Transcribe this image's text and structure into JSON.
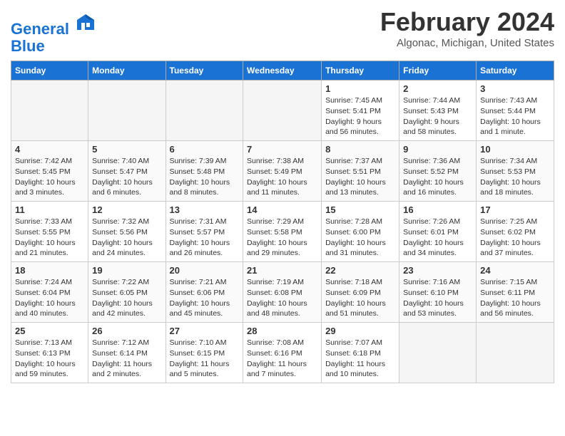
{
  "header": {
    "logo_line1": "General",
    "logo_line2": "Blue",
    "month": "February 2024",
    "location": "Algonac, Michigan, United States"
  },
  "days_of_week": [
    "Sunday",
    "Monday",
    "Tuesday",
    "Wednesday",
    "Thursday",
    "Friday",
    "Saturday"
  ],
  "weeks": [
    [
      {
        "num": "",
        "sunrise": "",
        "sunset": "",
        "daylight": "",
        "empty": true
      },
      {
        "num": "",
        "sunrise": "",
        "sunset": "",
        "daylight": "",
        "empty": true
      },
      {
        "num": "",
        "sunrise": "",
        "sunset": "",
        "daylight": "",
        "empty": true
      },
      {
        "num": "",
        "sunrise": "",
        "sunset": "",
        "daylight": "",
        "empty": true
      },
      {
        "num": "1",
        "sunrise": "Sunrise: 7:45 AM",
        "sunset": "Sunset: 5:41 PM",
        "daylight": "Daylight: 9 hours and 56 minutes."
      },
      {
        "num": "2",
        "sunrise": "Sunrise: 7:44 AM",
        "sunset": "Sunset: 5:43 PM",
        "daylight": "Daylight: 9 hours and 58 minutes."
      },
      {
        "num": "3",
        "sunrise": "Sunrise: 7:43 AM",
        "sunset": "Sunset: 5:44 PM",
        "daylight": "Daylight: 10 hours and 1 minute."
      }
    ],
    [
      {
        "num": "4",
        "sunrise": "Sunrise: 7:42 AM",
        "sunset": "Sunset: 5:45 PM",
        "daylight": "Daylight: 10 hours and 3 minutes."
      },
      {
        "num": "5",
        "sunrise": "Sunrise: 7:40 AM",
        "sunset": "Sunset: 5:47 PM",
        "daylight": "Daylight: 10 hours and 6 minutes."
      },
      {
        "num": "6",
        "sunrise": "Sunrise: 7:39 AM",
        "sunset": "Sunset: 5:48 PM",
        "daylight": "Daylight: 10 hours and 8 minutes."
      },
      {
        "num": "7",
        "sunrise": "Sunrise: 7:38 AM",
        "sunset": "Sunset: 5:49 PM",
        "daylight": "Daylight: 10 hours and 11 minutes."
      },
      {
        "num": "8",
        "sunrise": "Sunrise: 7:37 AM",
        "sunset": "Sunset: 5:51 PM",
        "daylight": "Daylight: 10 hours and 13 minutes."
      },
      {
        "num": "9",
        "sunrise": "Sunrise: 7:36 AM",
        "sunset": "Sunset: 5:52 PM",
        "daylight": "Daylight: 10 hours and 16 minutes."
      },
      {
        "num": "10",
        "sunrise": "Sunrise: 7:34 AM",
        "sunset": "Sunset: 5:53 PM",
        "daylight": "Daylight: 10 hours and 18 minutes."
      }
    ],
    [
      {
        "num": "11",
        "sunrise": "Sunrise: 7:33 AM",
        "sunset": "Sunset: 5:55 PM",
        "daylight": "Daylight: 10 hours and 21 minutes."
      },
      {
        "num": "12",
        "sunrise": "Sunrise: 7:32 AM",
        "sunset": "Sunset: 5:56 PM",
        "daylight": "Daylight: 10 hours and 24 minutes."
      },
      {
        "num": "13",
        "sunrise": "Sunrise: 7:31 AM",
        "sunset": "Sunset: 5:57 PM",
        "daylight": "Daylight: 10 hours and 26 minutes."
      },
      {
        "num": "14",
        "sunrise": "Sunrise: 7:29 AM",
        "sunset": "Sunset: 5:58 PM",
        "daylight": "Daylight: 10 hours and 29 minutes."
      },
      {
        "num": "15",
        "sunrise": "Sunrise: 7:28 AM",
        "sunset": "Sunset: 6:00 PM",
        "daylight": "Daylight: 10 hours and 31 minutes."
      },
      {
        "num": "16",
        "sunrise": "Sunrise: 7:26 AM",
        "sunset": "Sunset: 6:01 PM",
        "daylight": "Daylight: 10 hours and 34 minutes."
      },
      {
        "num": "17",
        "sunrise": "Sunrise: 7:25 AM",
        "sunset": "Sunset: 6:02 PM",
        "daylight": "Daylight: 10 hours and 37 minutes."
      }
    ],
    [
      {
        "num": "18",
        "sunrise": "Sunrise: 7:24 AM",
        "sunset": "Sunset: 6:04 PM",
        "daylight": "Daylight: 10 hours and 40 minutes."
      },
      {
        "num": "19",
        "sunrise": "Sunrise: 7:22 AM",
        "sunset": "Sunset: 6:05 PM",
        "daylight": "Daylight: 10 hours and 42 minutes."
      },
      {
        "num": "20",
        "sunrise": "Sunrise: 7:21 AM",
        "sunset": "Sunset: 6:06 PM",
        "daylight": "Daylight: 10 hours and 45 minutes."
      },
      {
        "num": "21",
        "sunrise": "Sunrise: 7:19 AM",
        "sunset": "Sunset: 6:08 PM",
        "daylight": "Daylight: 10 hours and 48 minutes."
      },
      {
        "num": "22",
        "sunrise": "Sunrise: 7:18 AM",
        "sunset": "Sunset: 6:09 PM",
        "daylight": "Daylight: 10 hours and 51 minutes."
      },
      {
        "num": "23",
        "sunrise": "Sunrise: 7:16 AM",
        "sunset": "Sunset: 6:10 PM",
        "daylight": "Daylight: 10 hours and 53 minutes."
      },
      {
        "num": "24",
        "sunrise": "Sunrise: 7:15 AM",
        "sunset": "Sunset: 6:11 PM",
        "daylight": "Daylight: 10 hours and 56 minutes."
      }
    ],
    [
      {
        "num": "25",
        "sunrise": "Sunrise: 7:13 AM",
        "sunset": "Sunset: 6:13 PM",
        "daylight": "Daylight: 10 hours and 59 minutes."
      },
      {
        "num": "26",
        "sunrise": "Sunrise: 7:12 AM",
        "sunset": "Sunset: 6:14 PM",
        "daylight": "Daylight: 11 hours and 2 minutes."
      },
      {
        "num": "27",
        "sunrise": "Sunrise: 7:10 AM",
        "sunset": "Sunset: 6:15 PM",
        "daylight": "Daylight: 11 hours and 5 minutes."
      },
      {
        "num": "28",
        "sunrise": "Sunrise: 7:08 AM",
        "sunset": "Sunset: 6:16 PM",
        "daylight": "Daylight: 11 hours and 7 minutes."
      },
      {
        "num": "29",
        "sunrise": "Sunrise: 7:07 AM",
        "sunset": "Sunset: 6:18 PM",
        "daylight": "Daylight: 11 hours and 10 minutes."
      },
      {
        "num": "",
        "sunrise": "",
        "sunset": "",
        "daylight": "",
        "empty": true
      },
      {
        "num": "",
        "sunrise": "",
        "sunset": "",
        "daylight": "",
        "empty": true
      }
    ]
  ]
}
